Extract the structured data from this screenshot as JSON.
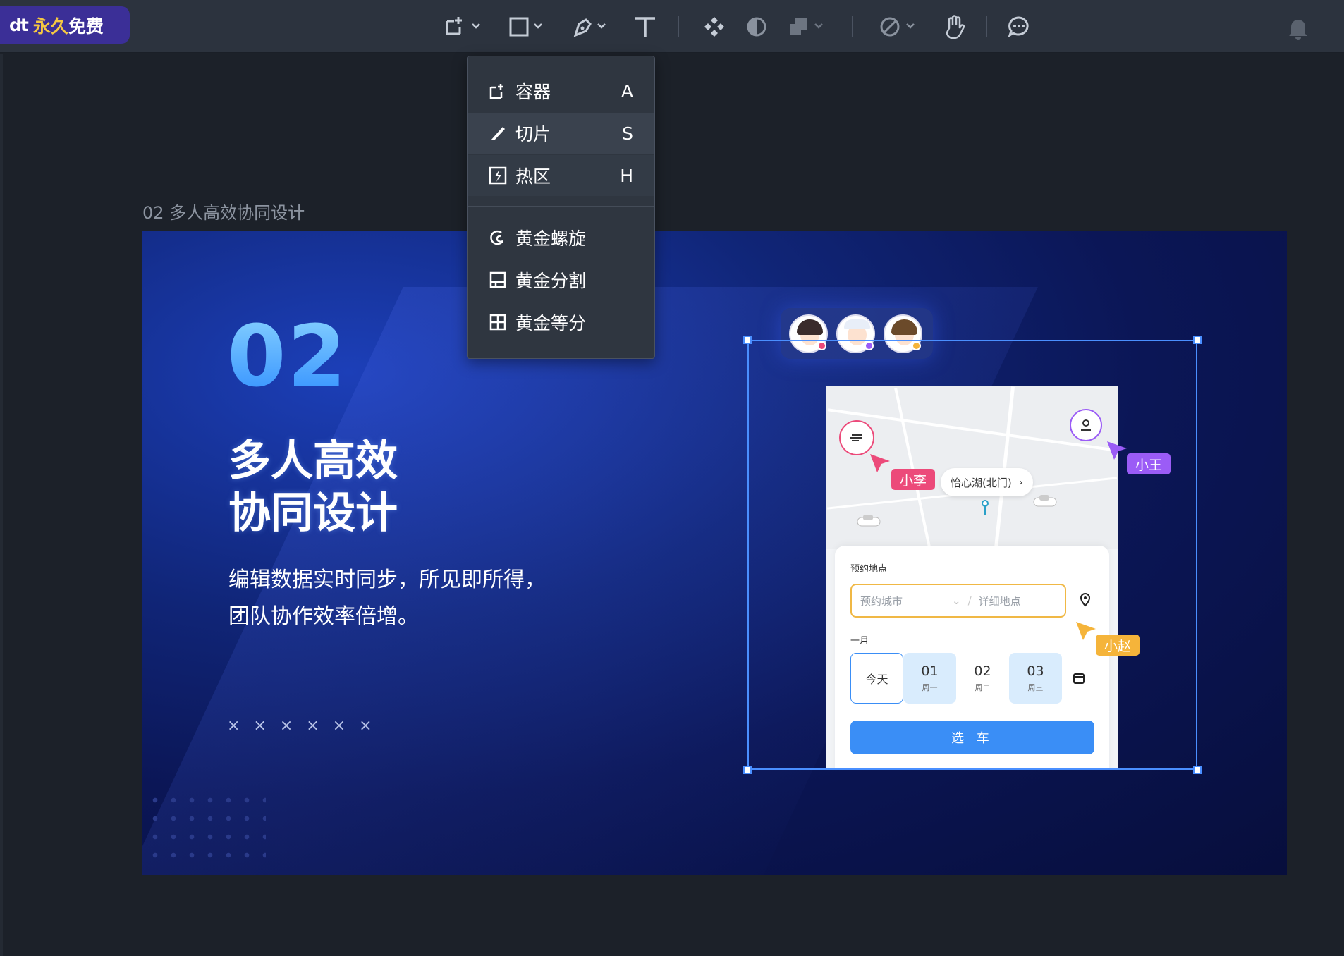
{
  "app": {
    "logo_brand": "dt",
    "logo_tag_a": "永久",
    "logo_tag_b": "免费"
  },
  "toolbar": {
    "tools": [
      "container-tool",
      "rectangle-tool",
      "pen-tool",
      "text-tool",
      "component-tool",
      "mask-tool",
      "boolean-tool",
      "prototype-tool",
      "hand-tool",
      "comment-tool"
    ]
  },
  "dropdown": {
    "items": [
      {
        "label": "容器",
        "key": "A",
        "icon": "container-icon"
      },
      {
        "label": "切片",
        "key": "S",
        "icon": "slice-icon"
      },
      {
        "label": "热区",
        "key": "H",
        "icon": "hotspot-icon"
      }
    ],
    "golden_items": [
      {
        "label": "黄金螺旋",
        "icon": "golden-spiral-icon"
      },
      {
        "label": "黄金分割",
        "icon": "golden-ratio-icon"
      },
      {
        "label": "黄金等分",
        "icon": "golden-grid-icon"
      }
    ]
  },
  "frame": {
    "title": "02 多人高效协同设计",
    "number": "02",
    "headline_line1": "多人高效",
    "headline_line2": "协同设计",
    "desc_line1": "编辑数据实时同步，所见即所得，",
    "desc_line2": "团队协作效率倍增。",
    "x_marks": "× × × × × ×"
  },
  "collab": {
    "users": [
      {
        "name": "小李",
        "color": "#ec4a7a"
      },
      {
        "name": "小王",
        "color": "#9b5cf6"
      },
      {
        "name": "小赵",
        "color": "#f5b43a"
      }
    ]
  },
  "phone": {
    "location": "怡心湖(北门)",
    "card_label": "预约地点",
    "city_placeholder": "预约城市",
    "detail_placeholder": "详细地点",
    "month": "一月",
    "dates": [
      {
        "n": "今天",
        "w": ""
      },
      {
        "n": "01",
        "w": "周一"
      },
      {
        "n": "02",
        "w": "周二"
      },
      {
        "n": "03",
        "w": "周三"
      }
    ],
    "button": "选 车"
  }
}
